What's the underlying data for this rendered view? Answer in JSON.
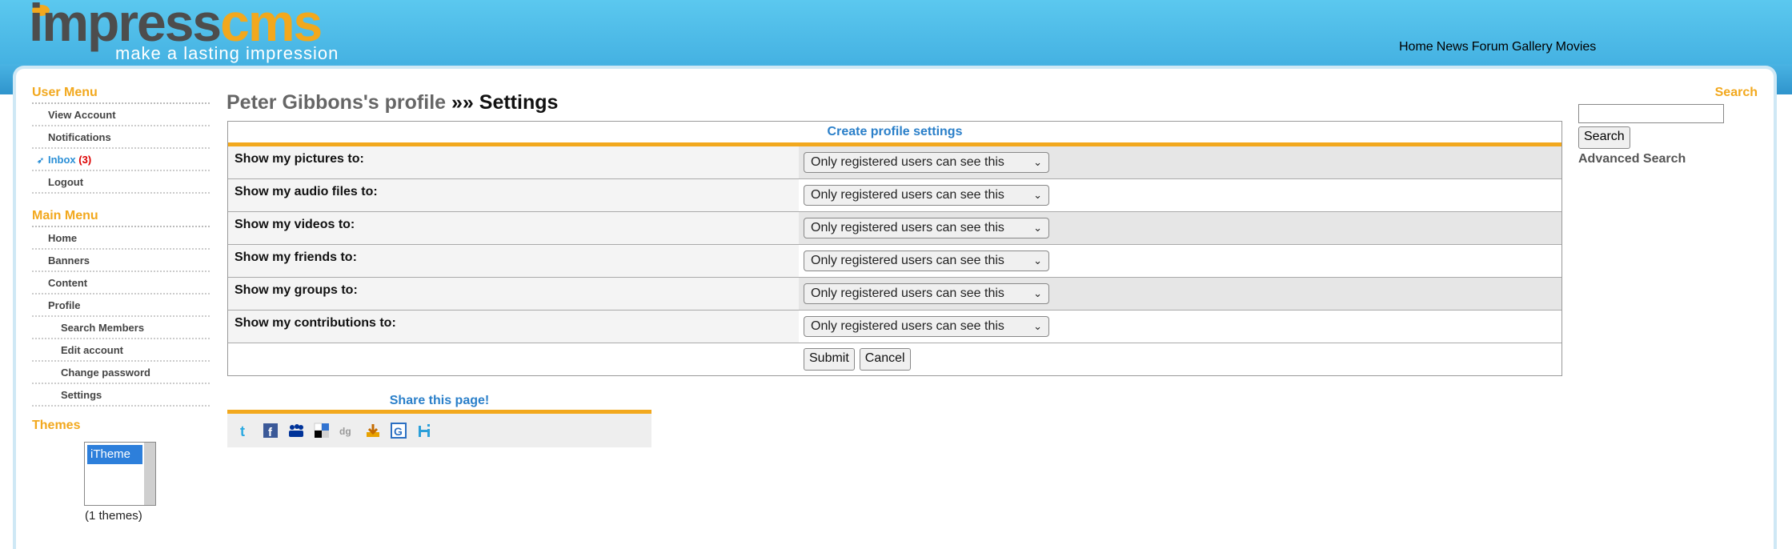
{
  "logo": {
    "impress": "impress",
    "cms": "cms",
    "tagline": "make a lasting impression"
  },
  "topnav": [
    "Home",
    "News",
    "Forum",
    "Gallery",
    "Movies"
  ],
  "user_menu": {
    "title": "User Menu",
    "items": [
      "View Account",
      "Notifications",
      "Inbox",
      "Logout"
    ],
    "inbox_count": "(3)"
  },
  "main_menu": {
    "title": "Main Menu",
    "items": [
      "Home",
      "Banners",
      "Content",
      "Profile"
    ],
    "subitems": [
      "Search Members",
      "Edit account",
      "Change password",
      "Settings"
    ]
  },
  "themes": {
    "title": "Themes",
    "selected": "iTheme",
    "count": "(1 themes)"
  },
  "page_title": {
    "profile": "Peter Gibbons's profile",
    "rest": "»» Settings"
  },
  "form": {
    "heading": "Create profile settings",
    "rows": [
      {
        "label": "Show my pictures to:",
        "value": "Only registered users can see this"
      },
      {
        "label": "Show my audio files to:",
        "value": "Only registered users can see this"
      },
      {
        "label": "Show my videos to:",
        "value": "Only registered users can see this"
      },
      {
        "label": "Show my friends to:",
        "value": "Only registered users can see this"
      },
      {
        "label": "Show my groups to:",
        "value": "Only registered users can see this"
      },
      {
        "label": "Show my contributions to:",
        "value": "Only registered users can see this"
      }
    ],
    "submit": "Submit",
    "cancel": "Cancel"
  },
  "share": {
    "title": "Share this page!",
    "icons": [
      "twitter-icon",
      "facebook-icon",
      "myspace-icon",
      "delicious-icon",
      "digg-icon",
      "stumbleupon-icon",
      "google-icon",
      "hi5-icon"
    ]
  },
  "search": {
    "title": "Search",
    "button": "Search",
    "advanced": "Advanced Search"
  }
}
